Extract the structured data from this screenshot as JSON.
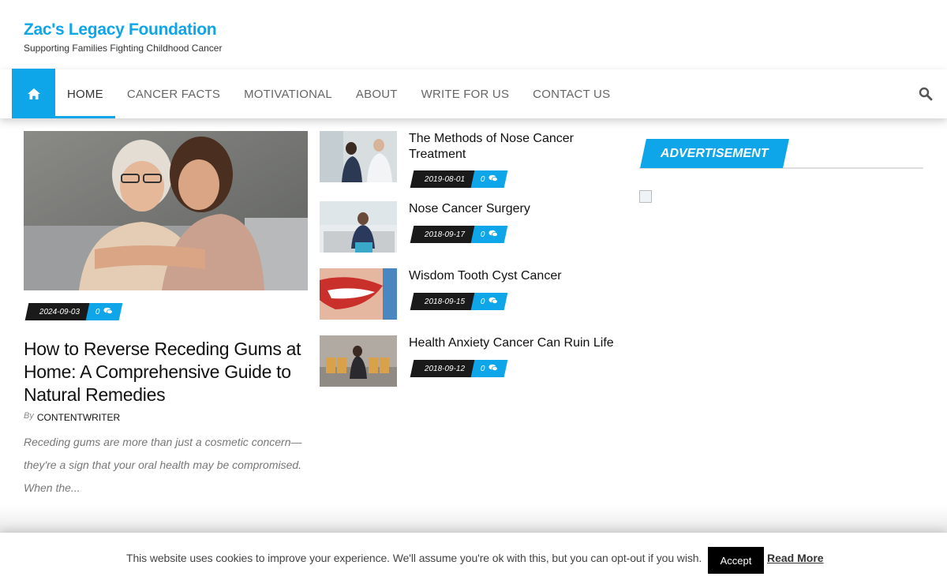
{
  "site": {
    "title": "Zac's Legacy Foundation",
    "tagline": "Supporting Families Fighting Childhood Cancer"
  },
  "nav": {
    "home_icon": "home-icon",
    "items": [
      {
        "label": "HOME",
        "active": true
      },
      {
        "label": "CANCER FACTS"
      },
      {
        "label": "MOTIVATIONAL"
      },
      {
        "label": "ABOUT"
      },
      {
        "label": "WRITE FOR US"
      },
      {
        "label": "CONTACT US"
      }
    ],
    "search_icon": "search-icon"
  },
  "featured": {
    "date": "2024-09-03",
    "comments": "0",
    "title": "How to Reverse Receding Gums at Home: A Comprehensive Guide to Natural Remedies",
    "by": "By",
    "author": "CONTENTWRITER",
    "excerpt": "Receding gums are more than just a cosmetic concern—they're a sign that your oral health may be compromised. When the..."
  },
  "posts": [
    {
      "title": "The Methods of Nose Cancer Treatment",
      "date": "2019-08-01",
      "comments": "0"
    },
    {
      "title": "Nose Cancer Surgery",
      "date": "2018-09-17",
      "comments": "0"
    },
    {
      "title": "Wisdom Tooth Cyst Cancer",
      "date": "2018-09-15",
      "comments": "0"
    },
    {
      "title": "Health Anxiety Cancer Can Ruin Life",
      "date": "2018-09-12",
      "comments": "0"
    }
  ],
  "sidebar": {
    "widget_title": "ADVERTISEMENT"
  },
  "cookie": {
    "text": "This website uses cookies to improve your experience. We'll assume you're ok with this, but you can opt-out if you wish.",
    "accept": "Accept",
    "read_more": "Read More"
  },
  "colors": {
    "accent": "#0ea5e9",
    "dark": "#1a1a1a"
  }
}
